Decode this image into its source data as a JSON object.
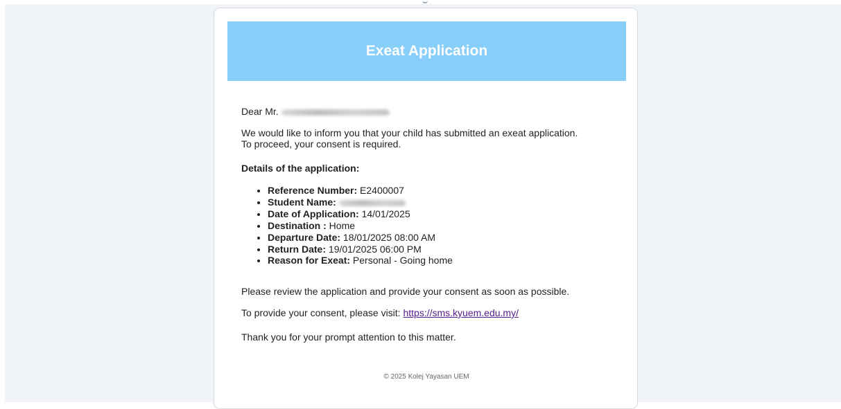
{
  "email": {
    "header_title": "Exeat Application",
    "greeting_prefix": "Dear Mr. ",
    "intro_line1": "We would like to inform you that your child has submitted an exeat application.",
    "intro_line2": "To proceed, your consent is required.",
    "details_heading": "Details of the application:",
    "details": [
      {
        "label": "Reference Number:",
        "value": " E2400007"
      },
      {
        "label": "Student Name:",
        "value": ""
      },
      {
        "label": "Date of Application:",
        "value": " 14/01/2025"
      },
      {
        "label": "Destination :",
        "value": " Home"
      },
      {
        "label": "Departure Date:",
        "value": " 18/01/2025 08:00 AM"
      },
      {
        "label": "Return Date:",
        "value": " 19/01/2025 06:00 PM"
      },
      {
        "label": "Reason for Exeat:",
        "value": " Personal - Going home"
      }
    ],
    "review_text": "Please review the application and provide your consent as soon as possible.",
    "consent_prefix": "To provide your consent, please visit: ",
    "consent_link": "https://sms.kyuem.edu.my/",
    "thanks_text": "Thank you for your prompt attention to this matter.",
    "footer": "© 2025 Kolej Yayasan UEM"
  },
  "colors": {
    "header_bg": "#87cefa",
    "link": "#551a8b",
    "page_bg": "#f0f4f9"
  }
}
